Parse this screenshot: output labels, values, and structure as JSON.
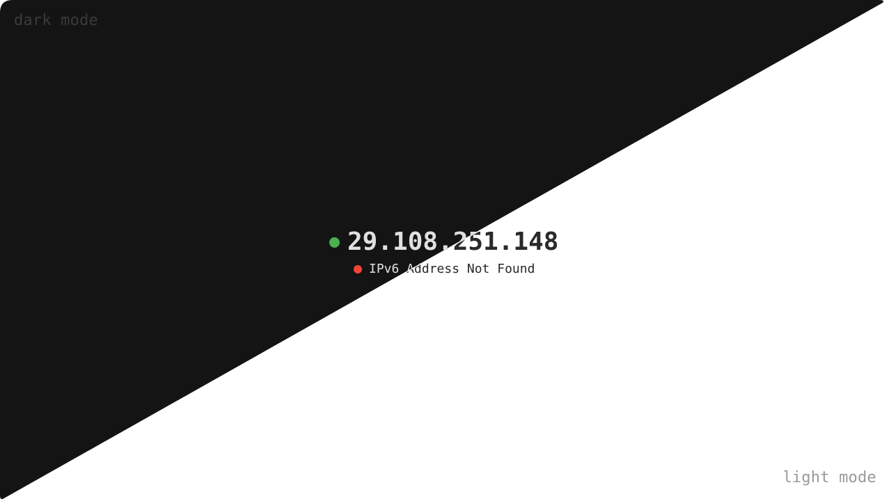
{
  "theme_toggle": {
    "dark_label": "dark mode",
    "light_label": "light mode"
  },
  "ip_status": {
    "ipv4": {
      "address": "29.108.251.148",
      "status": "ok",
      "status_color": "#4caf50"
    },
    "ipv6": {
      "message": "IPv6 Address Not Found",
      "status": "error",
      "status_color": "#f44336"
    }
  },
  "colors": {
    "dark_background": "#141414",
    "light_background": "#ffffff",
    "dark_label_color": "#3a3a3a",
    "light_label_color": "#9a9a9a",
    "dark_text": "#e0e0e0",
    "light_text": "#2a2a2a"
  }
}
